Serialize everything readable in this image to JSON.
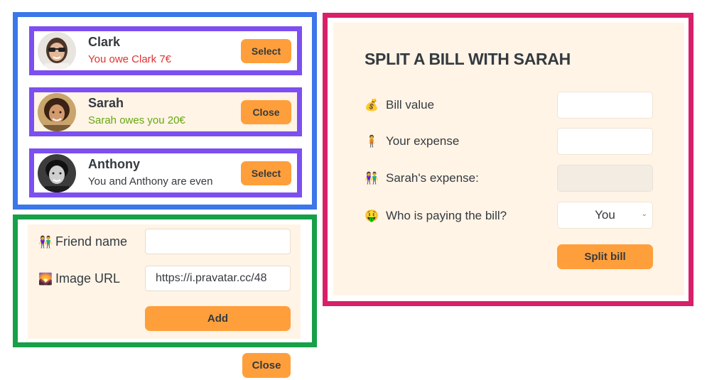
{
  "friends": [
    {
      "name": "Clark",
      "status": "You owe Clark 7€",
      "status_type": "red",
      "button": "Select",
      "avatar": "avatar-clark"
    },
    {
      "name": "Sarah",
      "status": "Sarah owes you 20€",
      "status_type": "green",
      "button": "Close",
      "avatar": "avatar-sarah"
    },
    {
      "name": "Anthony",
      "status": "You and Anthony are even",
      "status_type": "neutral",
      "button": "Select",
      "avatar": "avatar-anthony"
    }
  ],
  "add_form": {
    "name_icon": "👫",
    "name_label": "Friend name",
    "name_value": "",
    "image_icon": "🌄",
    "image_label": "Image URL",
    "image_value": "https://i.pravatar.cc/48",
    "add_label": "Add"
  },
  "close_button": "Close",
  "split": {
    "title": "SPLIT A BILL WITH SARAH",
    "bill_icon": "💰",
    "bill_label": "Bill value",
    "bill_value": "",
    "expense_icon": "🧍",
    "expense_label": "Your expense",
    "expense_value": "",
    "friend_expense_icon": "👫",
    "friend_expense_label": "Sarah's expense:",
    "friend_expense_value": "",
    "payer_icon": "🤑",
    "payer_label": "Who is paying the bill?",
    "payer_value": "You",
    "submit_label": "Split bill"
  },
  "colors": {
    "accent": "#ff9f3b",
    "panel_bg": "#fff4e6",
    "frame_blue": "#3b76ea",
    "frame_green": "#16a048",
    "frame_pink": "#d81f69",
    "frame_purple": "#7c4ff0",
    "owe_red": "#e03131",
    "owed_green": "#66a80f"
  }
}
